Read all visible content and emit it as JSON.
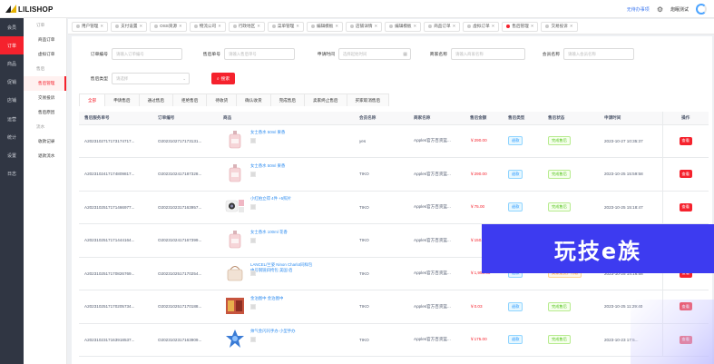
{
  "app": {
    "logo_text": "LILISHOP",
    "todo_link": "无待办事项",
    "username": "炮眠测试"
  },
  "colors": {
    "accent": "#f5222d",
    "sidebar": "#303643",
    "link": "#2d8cf0",
    "watermark": "#3d3bf0"
  },
  "main_menu": [
    {
      "label": "会员",
      "active": false
    },
    {
      "label": "订单",
      "active": true
    },
    {
      "label": "商品",
      "active": false
    },
    {
      "label": "促销",
      "active": false
    },
    {
      "label": "店铺",
      "active": false
    },
    {
      "label": "运营",
      "active": false
    },
    {
      "label": "统计",
      "active": false
    },
    {
      "label": "设置",
      "active": false
    },
    {
      "label": "日志",
      "active": false
    }
  ],
  "sub_menu": [
    {
      "type": "group",
      "label": "订单"
    },
    {
      "type": "item",
      "label": "商品订单",
      "active": false
    },
    {
      "type": "item",
      "label": "虚拟订单",
      "active": false
    },
    {
      "type": "group",
      "label": "售后"
    },
    {
      "type": "item",
      "label": "售后管理",
      "active": true
    },
    {
      "type": "item",
      "label": "交易投诉",
      "active": false
    },
    {
      "type": "item",
      "label": "售后原因",
      "active": false
    },
    {
      "type": "group",
      "label": "流水"
    },
    {
      "type": "item",
      "label": "收款记录",
      "active": false
    },
    {
      "type": "item",
      "label": "退款流水",
      "active": false
    }
  ],
  "tabs": [
    {
      "label": "用户管理",
      "active": false
    },
    {
      "label": "支付设置",
      "active": false
    },
    {
      "label": "OSS资源",
      "active": false
    },
    {
      "label": "物流公司",
      "active": false
    },
    {
      "label": "行政地区",
      "active": false
    },
    {
      "label": "菜单管理",
      "active": false
    },
    {
      "label": "编辑模板",
      "active": false
    },
    {
      "label": "店铺详情",
      "active": false
    },
    {
      "label": "编辑模板",
      "active": false
    },
    {
      "label": "商品订单",
      "active": false
    },
    {
      "label": "虚拟订单",
      "active": false
    },
    {
      "label": "售后管理",
      "active": true
    },
    {
      "label": "交易投诉",
      "active": false
    }
  ],
  "filters": {
    "order_no": {
      "label": "订单编号",
      "placeholder": "请输入订单编号"
    },
    "aftersale_no": {
      "label": "售后单号",
      "placeholder": "请输入售后单号"
    },
    "apply_time": {
      "label": "申请时间",
      "placeholder": "选择起始时间"
    },
    "merchant": {
      "label": "商家名称",
      "placeholder": "请输入商家名称"
    },
    "member": {
      "label": "会员名称",
      "placeholder": "请输入会员名称"
    },
    "aftersale_type": {
      "label": "售后类型",
      "placeholder": "请选择"
    },
    "search_button": "搜索"
  },
  "status_tabs": [
    {
      "label": "全部",
      "active": true
    },
    {
      "label": "申请售后",
      "active": false
    },
    {
      "label": "通过售后",
      "active": false
    },
    {
      "label": "拒绝售后",
      "active": false
    },
    {
      "label": "待收货",
      "active": false
    },
    {
      "label": "确认收货",
      "active": false
    },
    {
      "label": "完成售后",
      "active": false
    },
    {
      "label": "卖家终止售后",
      "active": false
    },
    {
      "label": "买家取消售后",
      "active": false
    }
  ],
  "table": {
    "columns": [
      "售后服务单号",
      "订单编号",
      "商品",
      "会员名称",
      "商家名称",
      "售后金额",
      "售后类型",
      "售后状态",
      "申请时间",
      "操作"
    ],
    "rows": [
      {
        "sn": "A2023102717173174717...",
        "order": "O2023102717173131...",
        "goods": "女士香水 50ml 果香",
        "thumb": "perfume",
        "member": "yes",
        "merchant": "Apples官方百货篮...",
        "amount": "￥290.00",
        "type": "退款",
        "status": "完成售后",
        "status_style": "green",
        "time": "2023-10-27 10:35:37",
        "action": "查看"
      },
      {
        "sn": "A2023102417174809817...",
        "order": "O2023102417187328...",
        "goods": "女士香水 50ml 果香",
        "thumb": "perfume",
        "member": "TIKO",
        "merchant": "Apples官方百货篮...",
        "amount": "￥290.00",
        "type": "退款",
        "status": "完成售后",
        "status_style": "green",
        "time": "2023-10-25 15:59:58",
        "action": "查看"
      },
      {
        "sn": "A2023102517171466977...",
        "order": "O2023102317163957...",
        "goods": "小红拍立得 4件 +5照片",
        "thumb": "camera",
        "member": "TIKO",
        "merchant": "Apples官方百货篮...",
        "amount": "￥75.00",
        "type": "退款",
        "status": "完成售后",
        "status_style": "green",
        "time": "2023-10-25 15:18:47",
        "action": "查看"
      },
      {
        "sn": "A2023102517171444164...",
        "order": "O2023102417167399...",
        "goods": "女士香水 100ml 花香",
        "thumb": "perfume",
        "member": "TIKO",
        "merchant": "Apples官方百货篮...",
        "amount": "￥150.00",
        "type": "退款",
        "status": "完成售后",
        "status_style": "green",
        "time": "2023-10-25 14:17:36",
        "action": "查看"
      },
      {
        "sn": "A2023102517170826769...",
        "order": "O2023102517170254...",
        "goods": "LANCEL/兰姿 Ninon Charlot同样包中号钢链斜挎包 美国 佰",
        "thumb": "bag",
        "member": "TIKO",
        "merchant": "Apples官方百货篮...",
        "amount": "￥1,950.00",
        "type": "退款",
        "status": "买家退货，待收",
        "status_style": "orange",
        "time": "2023-10-25 14:16:58",
        "action": "查看"
      },
      {
        "sn": "A2023102517170205734...",
        "order": "O2023102517170188...",
        "goods": "金泊图中 金泊图中",
        "thumb": "food",
        "member": "TIKO",
        "merchant": "Apples官方百货篮...",
        "amount": "￥0.03",
        "type": "退款",
        "status": "完成售后",
        "status_style": "green",
        "time": "2023-10-25 11:29:40",
        "action": "查看"
      },
      {
        "sn": "A2023102317163918537...",
        "order": "O2023102317163909...",
        "goods": "帅气金闪闪手办 小型手办",
        "thumb": "toy",
        "member": "TIKO",
        "merchant": "Apples官方百货篮...",
        "amount": "￥175.00",
        "type": "退款",
        "status": "完成售后",
        "status_style": "green",
        "time": "2023-10-23 17:5...",
        "action": "查看"
      }
    ]
  },
  "watermark": "玩技e族"
}
